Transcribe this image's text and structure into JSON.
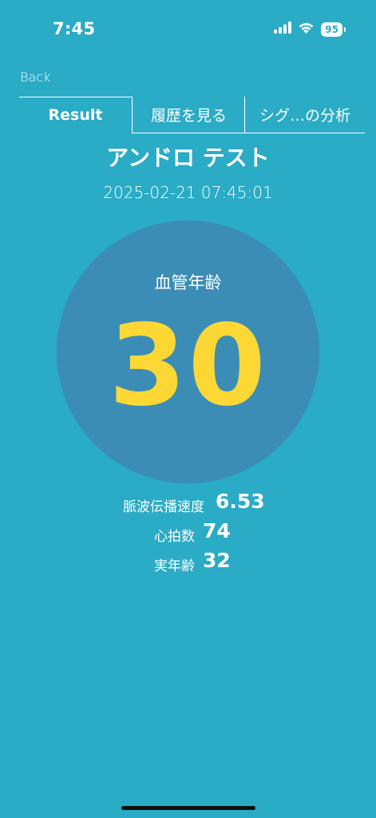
{
  "status_bar": {
    "time": "7:45",
    "battery": "95"
  },
  "nav": {
    "back_label": "Back"
  },
  "tabs": [
    {
      "label": "Result",
      "active": true
    },
    {
      "label": "履歴を見る",
      "active": false
    },
    {
      "label": "シグ…の分析",
      "active": false
    }
  ],
  "result": {
    "title": "アンドロ テスト",
    "datetime": "2025-02-21 07:45:01",
    "vascular_age_label": "血管年齢",
    "vascular_age_value": "30"
  },
  "stats": [
    {
      "label": "脈波伝播速度",
      "value": "6.53"
    },
    {
      "label": "心拍数",
      "value": "74"
    },
    {
      "label": "実年齢",
      "value": "32"
    }
  ],
  "colors": {
    "background": "#2AABC6",
    "circle": "#3B8DB5",
    "accent": "#FDD835"
  }
}
